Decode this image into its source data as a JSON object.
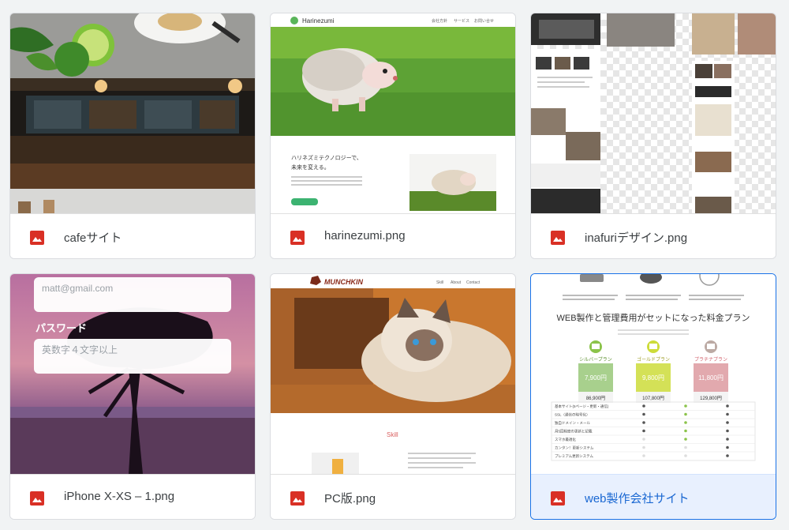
{
  "files": [
    {
      "name": "cafeサイト",
      "type_icon": "image-icon"
    },
    {
      "name": "harinezumi.png",
      "type_icon": "image-icon"
    },
    {
      "name": "inafuriデザイン.png",
      "type_icon": "image-icon"
    },
    {
      "name": "iPhone X-XS – 1.png",
      "type_icon": "image-icon"
    },
    {
      "name": "PC版.png",
      "type_icon": "image-icon"
    },
    {
      "name": "web製作会社サイト",
      "type_icon": "image-icon",
      "selected": true
    }
  ],
  "thumbnails": {
    "harinezumi": {
      "logo": "Harinezumi",
      "nav": [
        "会社方針",
        "サービス",
        "お問い合せ"
      ],
      "headline_line1": "ハリネズミテクノロジーで、",
      "headline_line2": "未来を変える。"
    },
    "iphone": {
      "email_placeholder": "matt@gmail.com",
      "password_label": "パスワード",
      "password_placeholder": "英数字４文字以上"
    },
    "pc": {
      "logo": "MUNCHKIN",
      "nav": [
        "Skill",
        "About",
        "Contact"
      ],
      "section_title": "Skill"
    },
    "web": {
      "heading": "WEB製作と管理費用がセットになった料金プラン",
      "plans": [
        {
          "name": "シルバープラン",
          "price": "7,900円",
          "setup": "86,900円"
        },
        {
          "name": "ゴールドプラン",
          "price": "9,800円",
          "setup": "107,800円"
        },
        {
          "name": "プラチナプラン",
          "price": "11,800円",
          "setup": "129,800円"
        }
      ],
      "features": [
        "基本サイト(5ページ・更新・通信)",
        "SSL（通信の暗号化）",
        "独自ドメイン・メール",
        "月5回程度の更新と記載",
        "スマホ最適化",
        "カンタン！更新システム",
        "プレミアム更新システム"
      ]
    }
  },
  "colors": {
    "file_icon_red": "#d93025",
    "selected_border": "#1a73e8",
    "selected_bg": "#e8f0fe"
  }
}
